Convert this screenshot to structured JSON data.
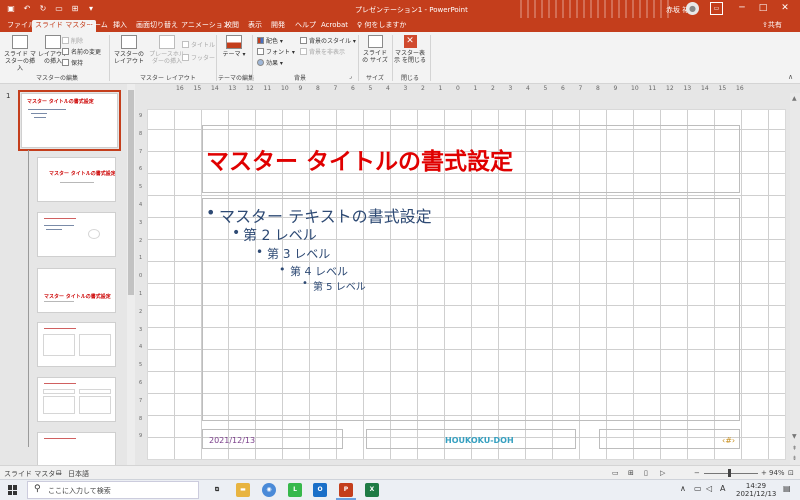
{
  "window": {
    "title": "プレゼンテーション1 - PowerPoint",
    "user": "赤坂 祐司",
    "controls": {
      "minimize": "─",
      "restore": "□",
      "close": "✕"
    }
  },
  "tabs": [
    {
      "label": "ファイル",
      "active": false
    },
    {
      "label": "スライド マスター",
      "active": true
    },
    {
      "label": "ホーム",
      "active": false
    },
    {
      "label": "挿入",
      "active": false
    },
    {
      "label": "画面切り替え",
      "active": false
    },
    {
      "label": "アニメーション",
      "active": false
    },
    {
      "label": "校閲",
      "active": false
    },
    {
      "label": "表示",
      "active": false
    },
    {
      "label": "開発",
      "active": false
    },
    {
      "label": "ヘルプ",
      "active": false
    },
    {
      "label": "Acrobat",
      "active": false
    }
  ],
  "tell_me": "何をしますか",
  "share": "共有",
  "ribbon": {
    "edit_master": {
      "insert_slide_master": "スライド マスターの挿入",
      "insert_layout": "レイアウトの挿入",
      "delete": "削除",
      "rename": "名前の変更",
      "preserve": "保持",
      "label": "マスターの編集"
    },
    "master_layout": {
      "master_layout": "マスターの レイアウト",
      "insert_placeholder": "プレースホルダーの挿入",
      "title": "タイトル",
      "footers": "フッター",
      "label": "マスター レイアウト"
    },
    "edit_theme": {
      "themes": "テーマ",
      "label": "テーマの編集"
    },
    "background": {
      "colors": "配色",
      "fonts": "フォント",
      "effects": "効果",
      "background_styles": "背景のスタイル",
      "hide_background": "背景を非表示",
      "label": "背景"
    },
    "size": {
      "slide_size": "スライドの サイズ",
      "label": "サイズ"
    },
    "close": {
      "close_master": "マスター表示 を閉じる",
      "label": "閉じる"
    }
  },
  "thumbnail_pane": {
    "master_number": "1",
    "master_title": "マスター タイトルの書式設定",
    "layout_title": "マスター タイトルの書式設定",
    "layout_section_title": "マスター タイトルの書式設定"
  },
  "ruler": {
    "h_ticks": [
      "16",
      "15",
      "14",
      "13",
      "12",
      "11",
      "10",
      "9",
      "8",
      "7",
      "6",
      "5",
      "4",
      "3",
      "2",
      "1",
      "0",
      "1",
      "2",
      "3",
      "4",
      "5",
      "6",
      "7",
      "8",
      "9",
      "10",
      "11",
      "12",
      "13",
      "14",
      "15",
      "16"
    ],
    "v_ticks": [
      "9",
      "8",
      "7",
      "6",
      "5",
      "4",
      "3",
      "2",
      "1",
      "0",
      "1",
      "2",
      "3",
      "4",
      "5",
      "6",
      "7",
      "8",
      "9"
    ]
  },
  "slide": {
    "title": "マスター タイトルの書式設定",
    "levels": [
      "マスター テキストの書式設定",
      "第 2 レベル",
      "第 3 レベル",
      "第 4 レベル",
      "第 5 レベル"
    ],
    "footer_date": "2021/12/13",
    "footer_text": "HOUKOKU-DOH",
    "footer_number": "‹#›"
  },
  "status": {
    "view": "スライド マスター",
    "language": "日本語",
    "zoom": "94%",
    "zoom_fraction": 0.47
  },
  "taskbar": {
    "search_placeholder": "ここに入力して検索",
    "time": "14:29",
    "date": "2021/12/13"
  }
}
